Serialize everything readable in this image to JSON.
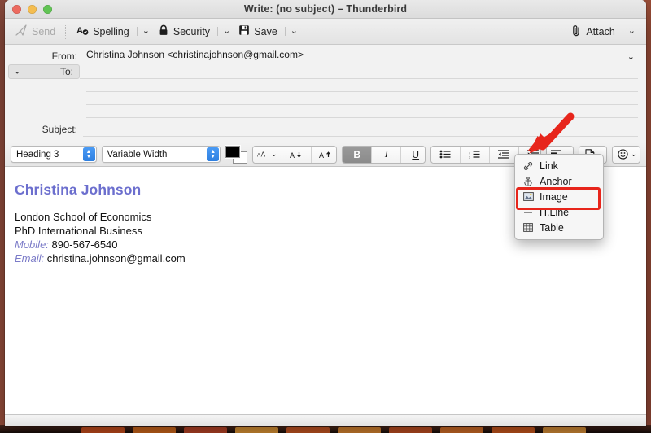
{
  "window": {
    "title": "Write: (no subject) – Thunderbird",
    "traffic_lights": [
      "close-red",
      "minimize-yellow",
      "maximize-green"
    ]
  },
  "main_toolbar": {
    "items": [
      {
        "label": "Send",
        "icon": "send-icon",
        "disabled": true,
        "caret": false
      },
      {
        "label": "Spelling",
        "icon": "spelling-icon",
        "disabled": false,
        "caret": true
      },
      {
        "label": "Security",
        "icon": "lock-icon",
        "disabled": false,
        "caret": true
      },
      {
        "label": "Save",
        "icon": "save-icon",
        "disabled": false,
        "caret": true
      }
    ],
    "attach": {
      "label": "Attach",
      "icon": "paperclip-icon",
      "caret": true
    }
  },
  "headers": {
    "from_label": "From:",
    "from_value": "Christina Johnson <christinajohnson@gmail.com>",
    "to_label": "To:",
    "to_value": "",
    "subject_label": "Subject:",
    "subject_value": ""
  },
  "format_toolbar": {
    "paragraph_format": "Heading 3",
    "font_family": "Variable Width",
    "foreground_color": "#000000",
    "background_color": "#ffffff",
    "buttons": [
      {
        "name": "font-size-icon",
        "glyph": "AA",
        "caret": true,
        "active": false
      },
      {
        "name": "decrease-size-icon",
        "glyph": "A",
        "caret": false,
        "active": false
      },
      {
        "name": "increase-size-icon",
        "glyph": "A",
        "caret": false,
        "active": false
      },
      {
        "name": "bold-button",
        "glyph": "B",
        "caret": false,
        "active": true
      },
      {
        "name": "italic-button",
        "glyph": "I",
        "caret": false,
        "active": false
      },
      {
        "name": "underline-button",
        "glyph": "U",
        "caret": false,
        "active": false
      },
      {
        "name": "bullet-list-button",
        "glyph": "",
        "caret": false,
        "active": false
      },
      {
        "name": "numbered-list-button",
        "glyph": "",
        "caret": false,
        "active": false
      },
      {
        "name": "outdent-button",
        "glyph": "",
        "caret": false,
        "active": false
      },
      {
        "name": "indent-button",
        "glyph": "",
        "caret": false,
        "active": false
      },
      {
        "name": "align-button",
        "glyph": "",
        "caret": true,
        "active": false
      },
      {
        "name": "insert-button",
        "glyph": "",
        "caret": true,
        "active": false
      },
      {
        "name": "emoticon-button",
        "glyph": "",
        "caret": true,
        "active": false
      }
    ]
  },
  "insert_menu": {
    "open": true,
    "highlight_color": "#e7251b",
    "highlighted_item": "Image",
    "items": [
      {
        "label": "Link",
        "icon": "link-icon"
      },
      {
        "label": "Anchor",
        "icon": "anchor-icon"
      },
      {
        "label": "Image",
        "icon": "image-icon"
      },
      {
        "label": "H.Line",
        "icon": "horizontal-line-icon"
      },
      {
        "label": "Table",
        "icon": "table-icon"
      }
    ]
  },
  "editor": {
    "signature_name": "Christina Johnson",
    "name_color": "#6c6fce",
    "label_color": "#7b7bc8",
    "lines": [
      {
        "label": "",
        "value": "London School of Economics"
      },
      {
        "label": "",
        "value": "PhD International Business"
      },
      {
        "label": "Mobile:",
        "value": "890-567-6540"
      },
      {
        "label": "Email:",
        "value": "christina.johnson@gmail.com"
      }
    ]
  },
  "annotation": {
    "arrow_color": "#e7251b",
    "points_to": "insert-button"
  }
}
